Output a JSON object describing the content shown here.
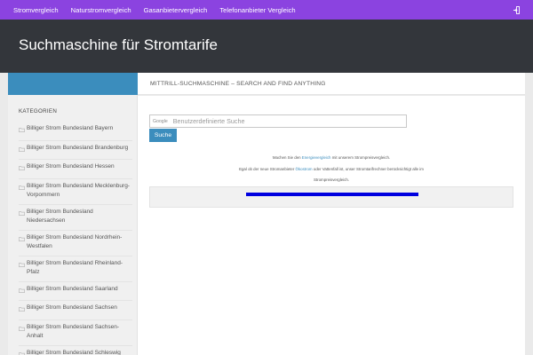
{
  "topnav": {
    "items": [
      "Stromvergleich",
      "Naturstromvergleich",
      "Gasanbietervergleich",
      "Telefonanbieter Vergleich"
    ],
    "toggle_icon": "login-icon"
  },
  "header": {
    "site_title": "Suchmaschine für Stromtarife"
  },
  "main": {
    "title": "Mittrill-Suchmaschine – Search and find anything"
  },
  "sidebar": {
    "widget_title": "KATEGORIEN",
    "items": [
      "Billiger Strom Bundesland Bayern",
      "Billiger Strom Bundesland Brandenburg",
      "Billiger Strom Bundesland Hessen",
      "Billiger Strom Bundesland Mecklenburg-Vorpommern",
      "Billiger Strom Bundesland Niedersachsen",
      "Billiger Strom Bundesland Nordrhein-Westfalen",
      "Billiger Strom Bundesland Rheinland-Pfalz",
      "Billiger Strom Bundesland Saarland",
      "Billiger Strom Bundesland Sachsen",
      "Billiger Strom Bundesland Sachsen-Anhalt",
      "Billiger Strom Bundesland Schleswig Holstein"
    ]
  },
  "search": {
    "provider": "Google",
    "placeholder": "Benutzerdefinierte Suche",
    "button_label": "Suche"
  },
  "info": {
    "line1_before": "Machen Sie den ",
    "line1_link": "Energievergleich",
    "line1_after": " mit unserem Strompreisvergleich.",
    "line2_before": "Egal ob der neue Stromanbieter ",
    "line2_link": "Ökostrom",
    "line2_after": " oder Vattenfall ist, unser Stromtarifrechner berücksichtigt alle im",
    "line3": "Strompreisvergleich."
  },
  "progress": {
    "percent": 100
  },
  "colors": {
    "nav_bg": "#8b43e0",
    "header_bg": "#33363b",
    "accent": "#3b8dbd",
    "progress": "#0000e0"
  }
}
